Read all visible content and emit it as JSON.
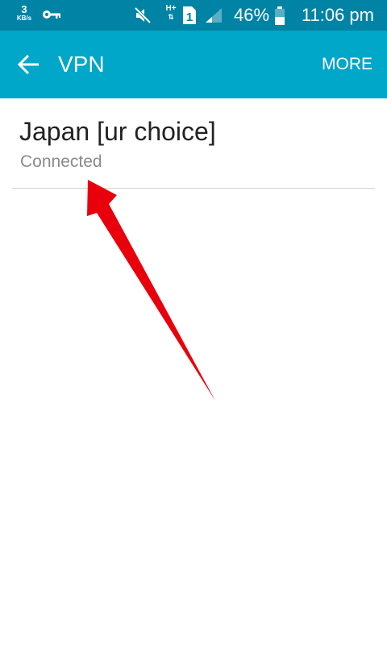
{
  "status_bar": {
    "net_speed_value": "3",
    "net_speed_unit": "KB/s",
    "network_type": "H+",
    "network_arrows": "⇅",
    "sim_slot": "1",
    "battery_percent": "46%",
    "time": "11:06 pm",
    "icons": [
      "key-icon",
      "mute-icon",
      "sim-icon",
      "signal-icon",
      "battery-icon"
    ]
  },
  "app_bar": {
    "back_icon": "arrow-left-icon",
    "title": "VPN",
    "more_label": "MORE"
  },
  "vpn_list": [
    {
      "name": "Japan [ur choice]",
      "status": "Connected"
    }
  ],
  "annotation": {
    "arrow_color": "#e8000d"
  },
  "colors": {
    "status_bar_bg": "#0083a4",
    "app_bar_bg": "#00a7c9",
    "primary_text": "#222222",
    "secondary_text": "#8a8a8a",
    "divider": "#d4d4d4"
  }
}
